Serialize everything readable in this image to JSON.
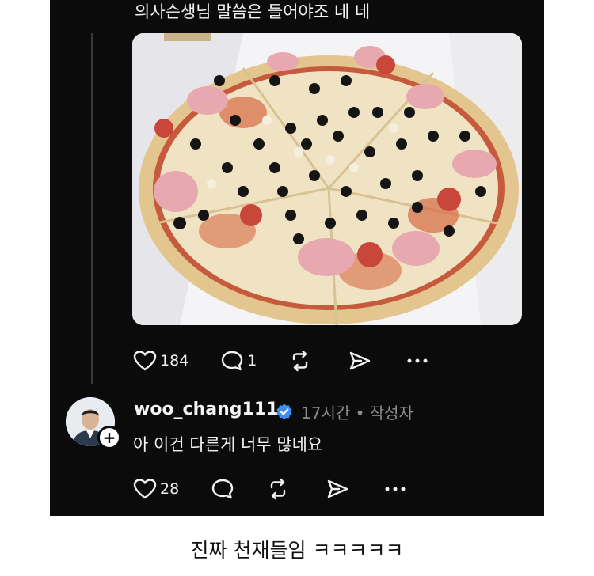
{
  "post": {
    "text": "의사슨생님 말씀은 들어야조 네 네",
    "photo_desc": "pizza-photo",
    "likes": "184",
    "comments": "1"
  },
  "reply": {
    "username": "woo_chang111",
    "time_meta": "17시간 • 작성자",
    "text": "아 이건 다른게 너무 많네요",
    "likes": "28"
  },
  "caption": "진짜 천재들임 ㅋㅋㅋㅋㅋ",
  "colors": {
    "panel_bg": "#0b0b0b",
    "text": "#f2f2f2",
    "muted": "#8c8c8c",
    "verified": "#3d8ef0"
  }
}
